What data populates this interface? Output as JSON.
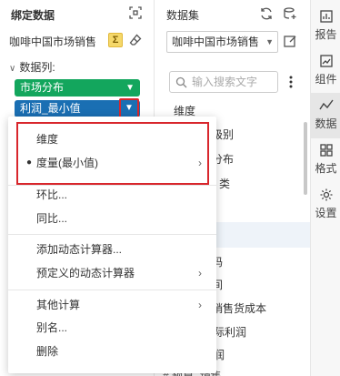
{
  "left_panel": {
    "title": "绑定数据",
    "dataset_name": "咖啡中国市场销售",
    "sum_symbol": "Σ",
    "data_columns_label": "数据列:",
    "fields": [
      {
        "label": "市场分布",
        "color": "#13a65d"
      },
      {
        "label": "利润_最小值",
        "color": "#1a6fb3"
      }
    ],
    "pill_caret": "▼"
  },
  "middle_panel": {
    "title": "数据集",
    "dataset_select": "咖啡中国市场销售",
    "search_placeholder": "输入搜索文字",
    "dimension_header": "维度",
    "visible_fragments": [
      "级别",
      "分布",
      "类",
      "码",
      "间",
      "销售货成本",
      "际利润",
      "润"
    ],
    "bottom_partial": "# 预算_销售"
  },
  "right_rail": {
    "items": [
      {
        "label": "报告",
        "icon": "report-icon"
      },
      {
        "label": "组件",
        "icon": "component-icon"
      },
      {
        "label": "数据",
        "icon": "data-icon",
        "active": true
      },
      {
        "label": "格式",
        "icon": "format-icon"
      },
      {
        "label": "设置",
        "icon": "settings-icon"
      }
    ]
  },
  "menu": {
    "items": [
      {
        "label": "维度",
        "submenu": false,
        "selected": false
      },
      {
        "label": "度量(最小值)",
        "submenu": true,
        "selected": true
      },
      {
        "label": "环比...",
        "submenu": false
      },
      {
        "label": "同比...",
        "submenu": false
      },
      {
        "label": "添加动态计算器...",
        "submenu": false
      },
      {
        "label": "预定义的动态计算器",
        "submenu": true
      },
      {
        "label": "其他计算",
        "submenu": true
      },
      {
        "label": "别名...",
        "submenu": false
      },
      {
        "label": "删除",
        "submenu": false
      }
    ],
    "submenu_arrow": "›",
    "bullet": "●"
  },
  "colors": {
    "accent_red": "#d8262c",
    "green_pill": "#13a65d",
    "blue_pill": "#1a6fb3"
  }
}
